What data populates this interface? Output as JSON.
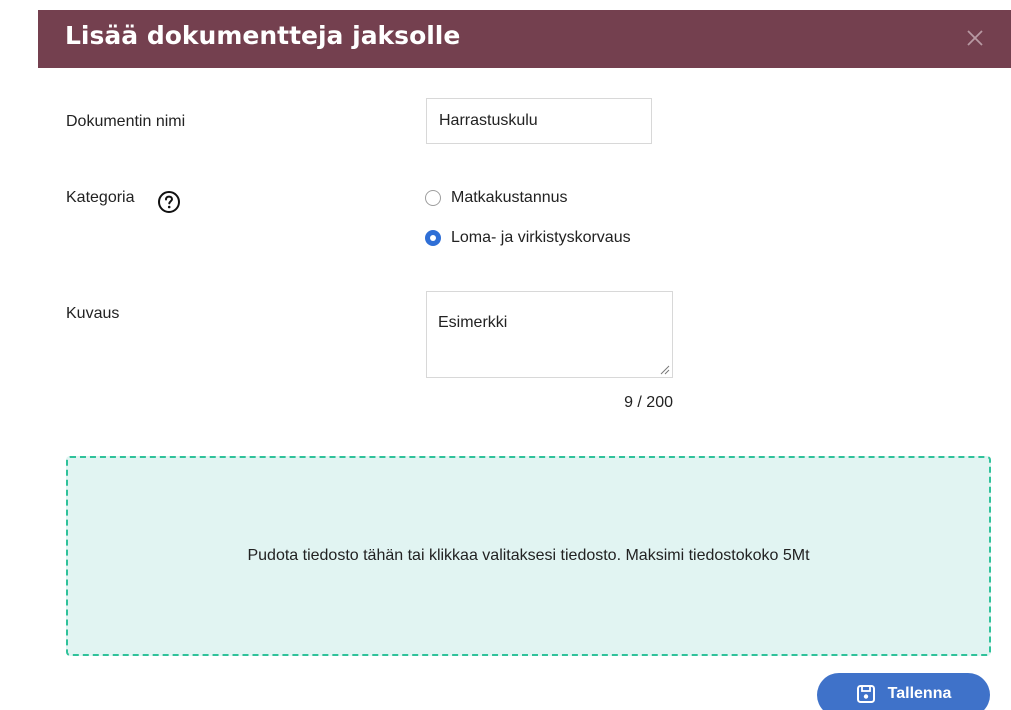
{
  "dialog": {
    "title": "Lisää dokumentteja jaksolle",
    "close_icon": "close-icon"
  },
  "form": {
    "name_label": "Dokumentin nimi",
    "name_value": "Harrastuskulu",
    "category_label": "Kategoria",
    "help_icon": "question-circle-icon",
    "category_options": [
      {
        "label": "Matkakustannus",
        "selected": false
      },
      {
        "label": "Loma- ja virkistyskorvaus",
        "selected": true
      }
    ],
    "description_label": "Kuvaus",
    "description_value": "Esimerkki",
    "description_counter": "9 / 200"
  },
  "dropzone": {
    "text": "Pudota tiedosto tähän tai klikkaa valitaksesi tiedosto. Maksimi tiedostokoko 5Mt"
  },
  "actions": {
    "save_label": "Tallenna",
    "save_icon": "floppy-disk-icon"
  },
  "colors": {
    "header_bg": "#74404f",
    "accent_blue": "#3f72c9",
    "radio_selected": "#2f6fd6",
    "dropzone_bg": "#e1f4f2",
    "dropzone_border": "#2fc29a"
  }
}
